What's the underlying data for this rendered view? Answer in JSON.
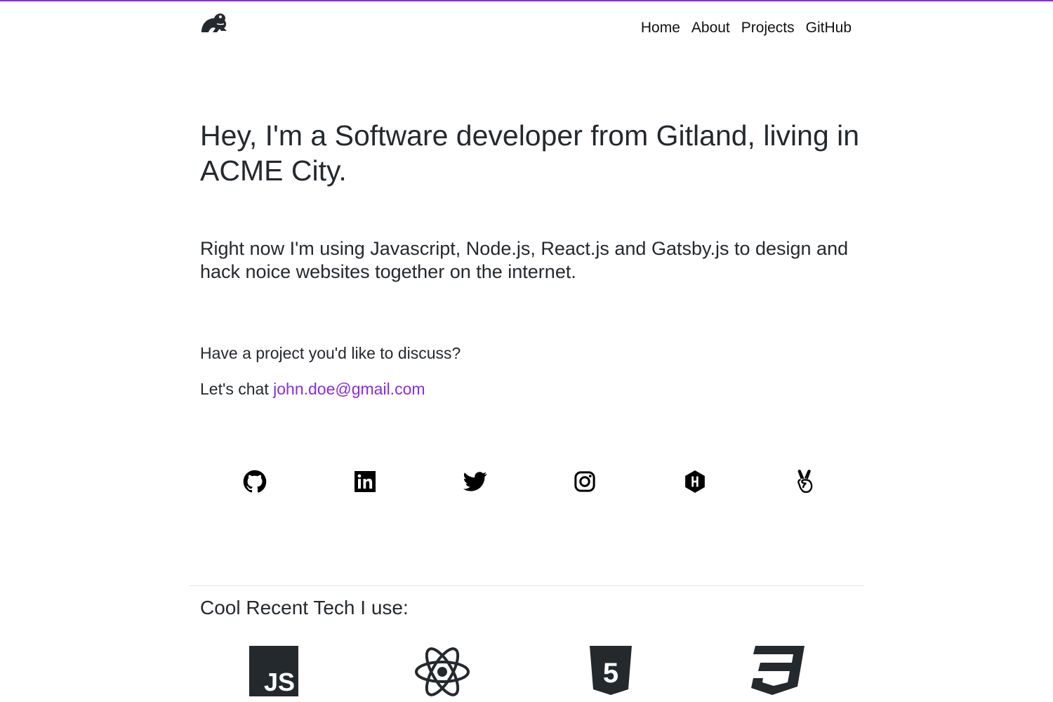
{
  "nav": {
    "logo_icon": "frog-logo-icon",
    "items": [
      {
        "label": "Home"
      },
      {
        "label": "About"
      },
      {
        "label": "Projects"
      },
      {
        "label": "GitHub"
      }
    ]
  },
  "hero": {
    "title": "Hey, I'm a Software developer from Gitland, living in ACME City.",
    "description": "Right now I'm using Javascript, Node.js, React.js and Gatsby.js to design and hack noice websites together on the internet.",
    "question": "Have a project you'd like to discuss?",
    "chat_prefix": "Let's chat",
    "email": "john.doe@gmail.com"
  },
  "social": [
    {
      "icon": "github-icon"
    },
    {
      "icon": "linkedin-icon"
    },
    {
      "icon": "twitter-icon"
    },
    {
      "icon": "instagram-icon"
    },
    {
      "icon": "hashnode-icon"
    },
    {
      "icon": "angellist-icon"
    }
  ],
  "tech": {
    "heading": "Cool Recent Tech I use:",
    "items": [
      {
        "icon": "javascript-icon",
        "label": "JS"
      },
      {
        "icon": "react-icon"
      },
      {
        "icon": "html5-icon",
        "label": "5"
      },
      {
        "icon": "css3-icon"
      }
    ]
  },
  "colors": {
    "accent": "#8a2be2",
    "text": "#24292e",
    "divider": "#e1e4e8"
  }
}
